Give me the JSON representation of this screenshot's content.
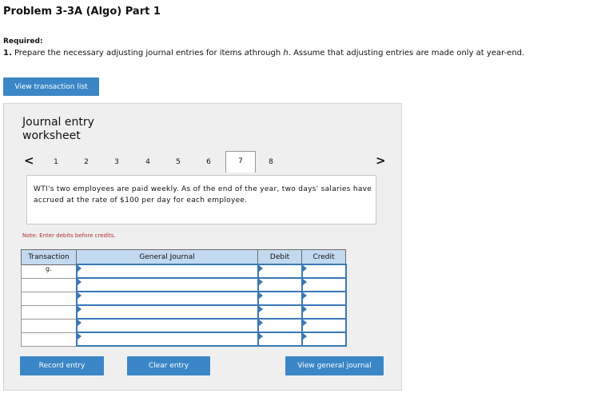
{
  "header": {
    "title": "Problem 3-3A (Algo) Part 1",
    "required": "Required:",
    "instruction_num": "1.",
    "instruction_pre": " Prepare the necessary adjusting journal entries for items ",
    "instruction_a": "a",
    "instruction_mid": "through ",
    "instruction_h": "h",
    "instruction_post": ". Assume that adjusting entries are made only at year-end."
  },
  "buttons": {
    "view_transaction_list": "View transaction list",
    "record_entry": "Record entry",
    "clear_entry": "Clear entry",
    "view_general_journal": "View general journal"
  },
  "worksheet": {
    "title_line1": "Journal entry",
    "title_line2": "worksheet",
    "prev_icon": "<",
    "next_icon": ">",
    "tabs": [
      "1",
      "2",
      "3",
      "4",
      "5",
      "6",
      "7",
      "8"
    ],
    "active_tab": "7",
    "description": "WTI's two employees are paid weekly. As of the end of the year, two days' salaries have accrued at the rate of $100 per day for each employee.",
    "note": "Note: Enter debits before credits."
  },
  "journal": {
    "columns": [
      "Transaction",
      "General Journal",
      "Debit",
      "Credit"
    ],
    "first_txn": "g.",
    "rows": [
      "",
      "",
      "",
      "",
      "",
      ""
    ]
  },
  "colors": {
    "button": "#3b86c6",
    "header": "#c3d9ef",
    "note": "#b03030"
  }
}
